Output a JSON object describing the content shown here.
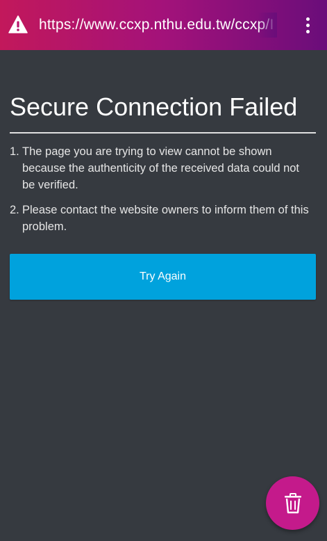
{
  "browser": {
    "url": "https://www.ccxp.nthu.edu.tw/ccxp/I",
    "warning_icon": "warning-triangle-icon",
    "menu_icon": "overflow-menu-icon",
    "accent_gradient": [
      "#c2185b",
      "#6a0d7a"
    ]
  },
  "error_page": {
    "title": "Secure Connection Failed",
    "reasons": [
      {
        "num": "1.",
        "text": "The page you are trying to view cannot be shown because the authenticity of the received data could not be verified."
      },
      {
        "num": "2.",
        "text": "Please contact the website owners to inform them of this problem."
      }
    ],
    "try_again_label": "Try Again",
    "button_color": "#00a2dd",
    "background_color": "#363a40"
  },
  "fab": {
    "icon": "trash-icon",
    "color": "#c41a8b"
  }
}
